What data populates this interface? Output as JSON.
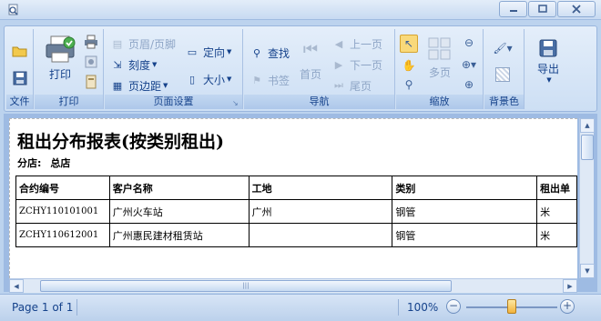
{
  "window": {
    "icon": "magnifier-doc-icon",
    "controls": [
      "minimize",
      "maximize",
      "close"
    ]
  },
  "ribbon": {
    "groups": {
      "file": {
        "label": "文件",
        "open": "open-icon",
        "save": "save-icon"
      },
      "print": {
        "label": "打印",
        "print_label": "打印"
      },
      "page_setup": {
        "label": "页面设置",
        "header_footer": "页眉/页脚",
        "scale": "刻度",
        "margins": "页边距",
        "orientation": "定向",
        "size": "大小"
      },
      "navigation": {
        "label": "导航",
        "find": "查找",
        "bookmark": "书签",
        "first_page": "首页",
        "prev_page": "上一页",
        "next_page": "下一页",
        "last_page": "尾页"
      },
      "zoom": {
        "label": "缩放",
        "many_pages": "多页"
      },
      "background": {
        "label": "背景色"
      },
      "export": {
        "label": "导出"
      }
    }
  },
  "report": {
    "title": "租出分布报表(按类别租出)",
    "branch_label": "分店:",
    "branch_value": "总店",
    "columns": [
      "合约编号",
      "客户名称",
      "工地",
      "类别",
      "租出单"
    ],
    "rows": [
      [
        "ZCHY110101001",
        "广州火车站",
        "广州",
        "钢管",
        "米"
      ],
      [
        "ZCHY110612001",
        "广州惠民建材租赁站",
        "",
        "钢管",
        "米"
      ]
    ]
  },
  "status": {
    "page_info": "Page 1 of 1",
    "zoom_percent": "100%",
    "zoom_level": 1.0
  },
  "colors": {
    "ribbon_bg": "#dbe7f7",
    "accent": "#15428b",
    "preview_bg": "#9ebbe3"
  }
}
